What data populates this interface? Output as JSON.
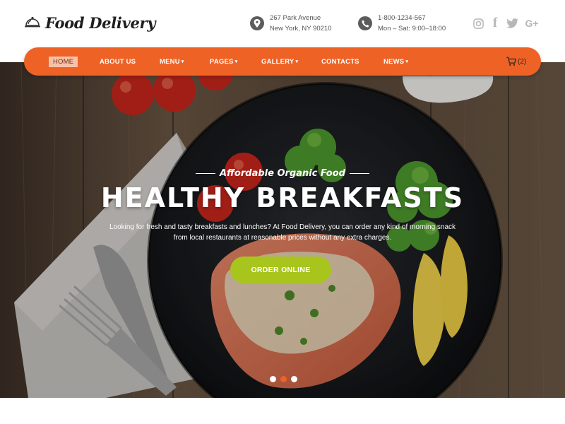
{
  "brand": {
    "name": "Food Delivery",
    "logo_icon": "cloche-icon"
  },
  "contact": {
    "address_line1": "267 Park Avenue",
    "address_line2": "New York, NY 90210",
    "phone": "1-800-1234-567",
    "hours": "Mon – Sat: 9:00–18:00",
    "address_icon": "map-pin-icon",
    "phone_icon": "phone-icon"
  },
  "social": [
    "instagram-icon",
    "facebook-icon",
    "twitter-icon",
    "google-plus-icon"
  ],
  "social_labels": {
    "gplus": "G+"
  },
  "nav": {
    "home": "HOME",
    "about": "ABOUT US",
    "menu": "MENU",
    "pages": "PAGES",
    "gallery": "GALLERY",
    "contacts": "CONTACTS",
    "news": "NEWS",
    "caret": "❯",
    "active": "home"
  },
  "cart": {
    "count": "(2)",
    "icon": "cart-icon"
  },
  "hero": {
    "subtitle": "Affordable Organic Food",
    "title": "HEALTHY BREAKFASTS",
    "text": "Looking for fresh and tasty breakfasts and lunches? At Food Delivery, you can order any kind of morning snack from local restaurants at reasonable prices without any extra charges.",
    "cta": "ORDER ONLINE",
    "slides": 3,
    "active_slide": 2
  },
  "colors": {
    "accent": "#ef6226",
    "cta": "#a8c51d",
    "text_dark": "#1e1e1e",
    "muted": "#b7b7b7"
  }
}
